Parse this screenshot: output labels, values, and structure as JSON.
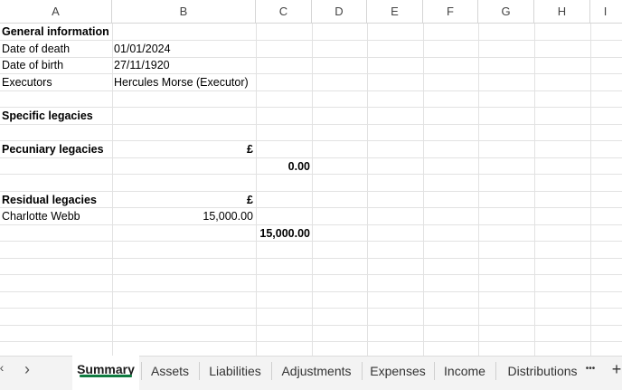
{
  "columns": [
    "A",
    "B",
    "C",
    "D",
    "E",
    "F",
    "G",
    "H",
    "I"
  ],
  "cells": {
    "a1": "General information",
    "a2": "Date of death",
    "b2": "01/01/2024",
    "a3": "Date of birth",
    "b3": "27/11/1920",
    "a4": "Executors",
    "b4": "Hercules Morse (Executor)",
    "a6": "Specific legacies",
    "a8": "Pecuniary legacies",
    "b8": "£",
    "c9": "0.00",
    "a11": "Residual legacies",
    "b11": "£",
    "a12": "Charlotte Webb",
    "b12": "15,000.00",
    "c13": "15,000.00"
  },
  "tabs": {
    "nav_prev": "‹",
    "nav_next": "›",
    "items": [
      "Summary",
      "Assets",
      "Liabilities",
      "Adjustments",
      "Expenses",
      "Income",
      "Distributions"
    ],
    "more": "•••",
    "add": "+"
  }
}
